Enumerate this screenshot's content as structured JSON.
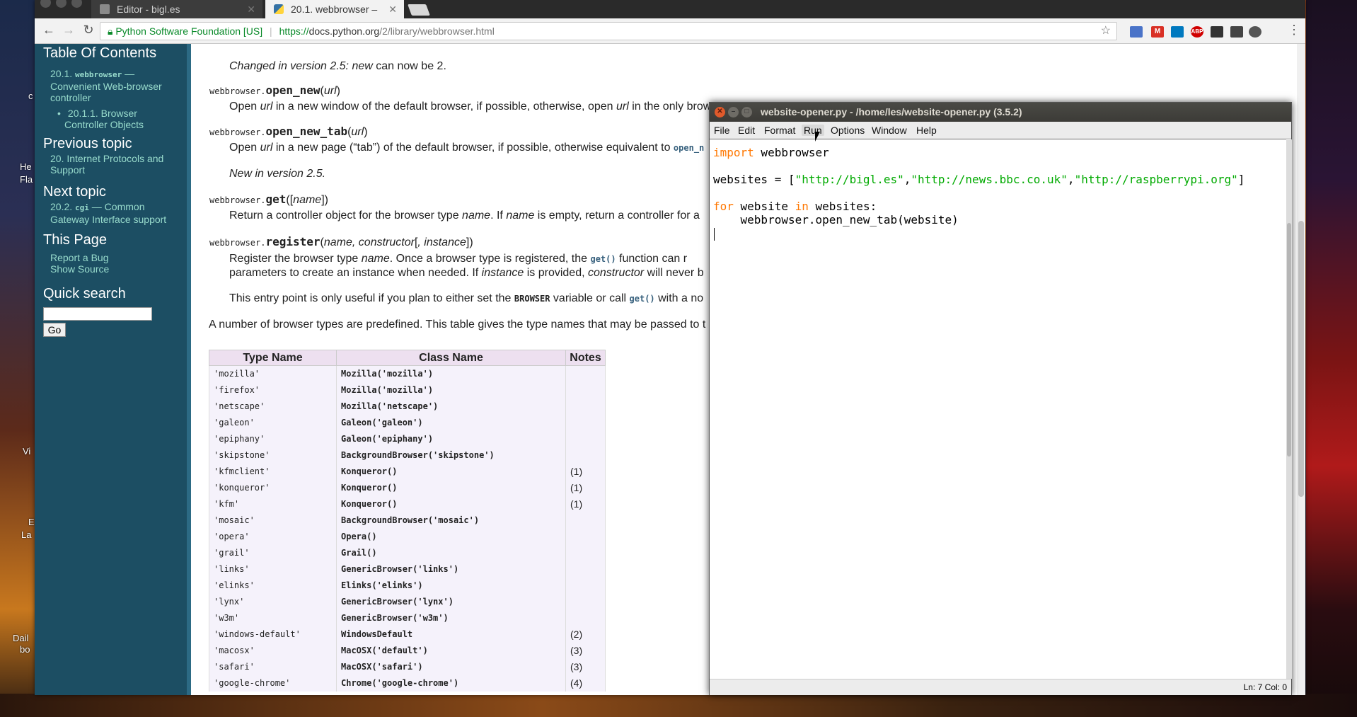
{
  "desktop": {
    "labels": [
      "c",
      "He",
      "Fla",
      "Vi",
      "E",
      "La",
      "Dail",
      "bo"
    ]
  },
  "browser": {
    "tabs": [
      {
        "title": "Editor - bigl.es",
        "active": false
      },
      {
        "title": "20.1. webbrowser –",
        "active": true
      }
    ],
    "omnibox": {
      "org": "Python Software Foundation [US]",
      "scheme": "https://",
      "host": "docs.python.org",
      "path": "/2/library/webbrowser.html"
    },
    "extensions": [
      {
        "name": "gsuite-icon",
        "color": "#4a73c8"
      },
      {
        "name": "gmail-icon",
        "color": "#d93025"
      },
      {
        "name": "trello-icon",
        "color": "#0079bf"
      },
      {
        "name": "adblock-icon",
        "color": "#d00000",
        "label": "ABP"
      },
      {
        "name": "terminal-icon",
        "color": "#333"
      },
      {
        "name": "camera-icon",
        "color": "#444"
      },
      {
        "name": "gear-icon",
        "color": "#555"
      }
    ]
  },
  "sidebar": {
    "toc_title": "Table Of Contents",
    "toc_item_1_prefix": "20.1. ",
    "toc_item_1_code": "webbrowser",
    "toc_item_1_suffix": " —",
    "toc_item_1_line2": "Convenient Web-browser",
    "toc_item_1_line3": "controller",
    "toc_sub_line1": "20.1.1. Browser",
    "toc_sub_line2": "Controller Objects",
    "prev_title": "Previous topic",
    "prev_line1": "20. Internet Protocols and",
    "prev_line2": "Support",
    "next_title": "Next topic",
    "next_prefix": "20.2. ",
    "next_code": "cgi",
    "next_suffix": " — Common",
    "next_line2": "Gateway Interface support",
    "this_page_title": "This Page",
    "report_bug": "Report a Bug",
    "show_source": "Show Source",
    "quick_search_title": "Quick search",
    "go_label": "Go"
  },
  "doc": {
    "changed_25_italic": "Changed in version 2.5: ",
    "changed_25_new": "new",
    "changed_25_rest": " can now be 2.",
    "open_new_mod": "webbrowser.",
    "open_new_name": "open_new",
    "open_new_args": "url",
    "open_new_desc_1": "Open ",
    "open_new_desc_url": "url",
    "open_new_desc_2": " in a new window of the default browser, if possible, otherwise, open ",
    "open_new_desc_url2": "url",
    "open_new_desc_3": " in the only brow",
    "open_new_tab_mod": "webbrowser.",
    "open_new_tab_name": "open_new_tab",
    "open_new_tab_args": "url",
    "open_new_tab_desc_1": "Open ",
    "open_new_tab_desc_url": "url",
    "open_new_tab_desc_2": " in a new page (“tab”) of the default browser, if possible, otherwise equivalent to ",
    "open_new_tab_desc_code": "open_n",
    "new_in_25": "New in version 2.5.",
    "get_mod": "webbrowser.",
    "get_name": "get",
    "get_args": "name",
    "get_desc_1": "Return a controller object for the browser type ",
    "get_desc_name": "name",
    "get_desc_2": ". If ",
    "get_desc_name2": "name",
    "get_desc_3": " is empty, return a controller for a",
    "register_mod": "webbrowser.",
    "register_name": "register",
    "register_args_1": "name",
    "register_args_2": ", constructor",
    "register_args_3": ", instance",
    "register_desc_1": "Register the browser type ",
    "register_desc_name": "name",
    "register_desc_2": ". Once a browser type is registered, the ",
    "register_desc_code": "get()",
    "register_desc_3": " function can r",
    "register_line2_1": "parameters to create an instance when needed. If ",
    "register_line2_instance": "instance",
    "register_line2_2": " is provided, ",
    "register_line2_constructor": "constructor",
    "register_line2_3": " will never b",
    "entry_1": "This entry point is only useful if you plan to either set the ",
    "entry_browser": "BROWSER",
    "entry_2": " variable or call ",
    "entry_get": "get()",
    "entry_3": " with a no",
    "predefined": "A number of browser types are predefined. This table gives the type names that may be passed to t"
  },
  "table": {
    "headers": [
      "Type Name",
      "Class Name",
      "Notes"
    ],
    "rows": [
      [
        "'mozilla'",
        "Mozilla('mozilla')",
        ""
      ],
      [
        "'firefox'",
        "Mozilla('mozilla')",
        ""
      ],
      [
        "'netscape'",
        "Mozilla('netscape')",
        ""
      ],
      [
        "'galeon'",
        "Galeon('galeon')",
        ""
      ],
      [
        "'epiphany'",
        "Galeon('epiphany')",
        ""
      ],
      [
        "'skipstone'",
        "BackgroundBrowser('skipstone')",
        ""
      ],
      [
        "'kfmclient'",
        "Konqueror()",
        "(1)"
      ],
      [
        "'konqueror'",
        "Konqueror()",
        "(1)"
      ],
      [
        "'kfm'",
        "Konqueror()",
        "(1)"
      ],
      [
        "'mosaic'",
        "BackgroundBrowser('mosaic')",
        ""
      ],
      [
        "'opera'",
        "Opera()",
        ""
      ],
      [
        "'grail'",
        "Grail()",
        ""
      ],
      [
        "'links'",
        "GenericBrowser('links')",
        ""
      ],
      [
        "'elinks'",
        "Elinks('elinks')",
        ""
      ],
      [
        "'lynx'",
        "GenericBrowser('lynx')",
        ""
      ],
      [
        "'w3m'",
        "GenericBrowser('w3m')",
        ""
      ],
      [
        "'windows-default'",
        "WindowsDefault",
        "(2)"
      ],
      [
        "'macosx'",
        "MacOSX('default')",
        "(3)"
      ],
      [
        "'safari'",
        "MacOSX('safari')",
        "(3)"
      ],
      [
        "'google-chrome'",
        "Chrome('google-chrome')",
        "(4)"
      ]
    ]
  },
  "idle": {
    "title": "website-opener.py - /home/les/website-opener.py (3.5.2)",
    "menus": [
      "File",
      "Edit",
      "Format",
      "Run",
      "Options",
      "Window",
      "Help"
    ],
    "hovered_menu": "Run",
    "code": {
      "l1_kw": "import",
      "l1_rest": " webbrowser",
      "l2_pre": "websites = [",
      "l2_s1": "\"http://bigl.es\"",
      "l2_c1": ",",
      "l2_s2": "\"http://news.bbc.co.uk\"",
      "l2_c2": ",",
      "l2_s3": "\"http://raspberrypi.org\"",
      "l2_post": "]",
      "l3_kw1": "for",
      "l3_mid": " website ",
      "l3_kw2": "in",
      "l3_rest": " websites:",
      "l4": "    webbrowser.open_new_tab(website)"
    },
    "status": "Ln: 7   Col: 0"
  }
}
